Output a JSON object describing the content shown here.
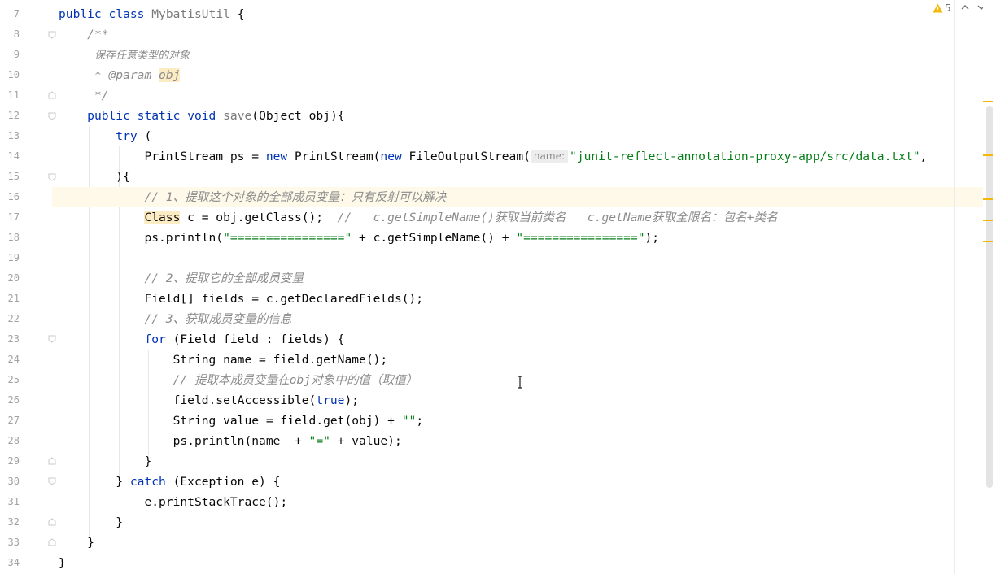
{
  "editor": {
    "inspection": {
      "warning_count": "5"
    },
    "lines": [
      {
        "n": "7"
      },
      {
        "n": "8"
      },
      {
        "n": "9"
      },
      {
        "n": "10"
      },
      {
        "n": "11"
      },
      {
        "n": "12"
      },
      {
        "n": "13"
      },
      {
        "n": "14"
      },
      {
        "n": "15"
      },
      {
        "n": "16"
      },
      {
        "n": "17"
      },
      {
        "n": "18"
      },
      {
        "n": "19"
      },
      {
        "n": "20"
      },
      {
        "n": "21"
      },
      {
        "n": "22"
      },
      {
        "n": "23"
      },
      {
        "n": "24"
      },
      {
        "n": "25"
      },
      {
        "n": "26"
      },
      {
        "n": "27"
      },
      {
        "n": "28"
      },
      {
        "n": "29"
      },
      {
        "n": "30"
      },
      {
        "n": "31"
      },
      {
        "n": "32"
      },
      {
        "n": "33"
      },
      {
        "n": "34"
      }
    ],
    "code": {
      "l7": {
        "kw1": "public",
        "kw2": "class",
        "name": "MybatisUtil",
        "rest": " {"
      },
      "l8": {
        "text": "/**"
      },
      "l9": {
        "text": "保存任意类型的对象"
      },
      "l10": {
        "star": "* ",
        "tag": "@param",
        "param": "obj"
      },
      "l11": {
        "text": "*/"
      },
      "l12": {
        "kw1": "public",
        "kw2": "static",
        "kw3": "void",
        "fn": "save",
        "rest": "(Object obj){"
      },
      "l13": {
        "kw": "try",
        "rest": " ("
      },
      "l14": {
        "a": "PrintStream ps = ",
        "kw": "new",
        "b": " PrintStream(",
        "kw2": "new",
        "c": " FileOutputStream(",
        "hint": "name:",
        "str": "\"junit-reflect-annotation-proxy-app/src/data.txt\"",
        "d": ","
      },
      "l15": {
        "text": "){"
      },
      "l16": {
        "cm": "// 1、提取这个对象的全部成员变量：只有反射可以解决"
      },
      "l17": {
        "cls": "Class",
        "a": " c = obj.getClass();  ",
        "cm": "//   c.getSimpleName()获取当前类名   c.getName获取全限名：包名+类名"
      },
      "l18": {
        "a": "ps.println(",
        "s1": "\"================\"",
        "b": " + c.getSimpleName() + ",
        "s2": "\"================\"",
        "c": ");"
      },
      "l19": {
        "text": ""
      },
      "l20": {
        "cm": "// 2、提取它的全部成员变量"
      },
      "l21": {
        "text": "Field[] fields = c.getDeclaredFields();"
      },
      "l22": {
        "cm": "// 3、获取成员变量的信息"
      },
      "l23": {
        "kw": "for",
        "rest": " (Field field : fields) {"
      },
      "l24": {
        "text": "String name = field.getName();"
      },
      "l25": {
        "cm": "// 提取本成员变量在obj对象中的值（取值）"
      },
      "l26": {
        "a": "field.setAccessible(",
        "kw": "true",
        "b": ");"
      },
      "l27": {
        "a": "String value = field.get(obj) + ",
        "str": "\"\"",
        "b": ";"
      },
      "l28": {
        "a": "ps.println(name  + ",
        "str": "\"=\"",
        "b": " + value);"
      },
      "l29": {
        "text": "}"
      },
      "l30": {
        "a": "} ",
        "kw": "catch",
        "b": " (Exception e) {"
      },
      "l31": {
        "text": "e.printStackTrace();"
      },
      "l32": {
        "text": "}"
      },
      "l33": {
        "text": "}"
      },
      "l34": {
        "text": "}"
      }
    }
  },
  "colors": {
    "keyword": "#0033b3",
    "string": "#067d17",
    "comment": "#8c8c8c",
    "function": "#00627a",
    "warning": "#f5b700",
    "current_line": "#fef9e9"
  }
}
